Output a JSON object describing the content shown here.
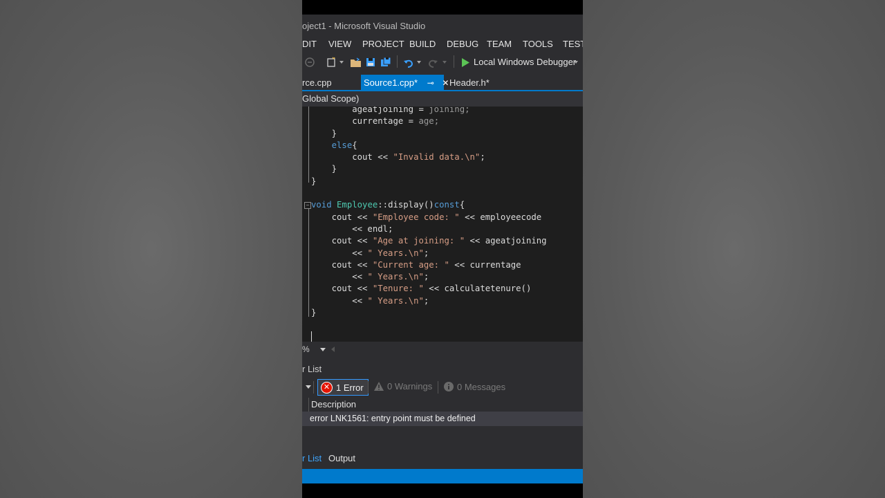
{
  "window": {
    "title": "oject1 - Microsoft Visual Studio"
  },
  "menu": [
    "DIT",
    "VIEW",
    "PROJECT",
    "BUILD",
    "DEBUG",
    "TEAM",
    "TOOLS",
    "TEST"
  ],
  "toolbar": {
    "debugger_label": "Local Windows Debugger"
  },
  "tabs": [
    {
      "label": "rce.cpp"
    },
    {
      "label": "Source1.cpp*",
      "active": true
    },
    {
      "label": "Header.h*"
    }
  ],
  "scope": {
    "label": "Global Scope)"
  },
  "editor": {
    "zoom": "%",
    "code": [
      [
        [
          "",
          "        ageatjoining = "
        ],
        [
          "dim",
          "joining;"
        ]
      ],
      [
        [
          "",
          "        currentage = "
        ],
        [
          "dim",
          "age;"
        ]
      ],
      [
        [
          "",
          "    }"
        ]
      ],
      [
        [
          "kw",
          "    else"
        ],
        [
          "",
          "{"
        ]
      ],
      [
        [
          "",
          "        cout << "
        ],
        [
          "st",
          "\"Invalid data.\\n\""
        ],
        [
          "",
          ";"
        ]
      ],
      [
        [
          "",
          "    }"
        ]
      ],
      [
        [
          "",
          "}"
        ]
      ],
      [
        [
          "",
          ""
        ]
      ],
      [
        [
          "kw",
          "void"
        ],
        [
          "",
          " "
        ],
        [
          "ty",
          "Employee"
        ],
        [
          "",
          "::display()"
        ],
        [
          "kw",
          "const"
        ],
        [
          "",
          "{"
        ]
      ],
      [
        [
          "",
          "    cout << "
        ],
        [
          "st",
          "\"Employee code: \""
        ],
        [
          "",
          " << employeecode"
        ]
      ],
      [
        [
          "",
          "        << endl;"
        ]
      ],
      [
        [
          "",
          "    cout << "
        ],
        [
          "st",
          "\"Age at joining: \""
        ],
        [
          "",
          " << ageatjoining"
        ]
      ],
      [
        [
          "",
          "        << "
        ],
        [
          "st",
          "\" Years.\\n\""
        ],
        [
          "",
          ";"
        ]
      ],
      [
        [
          "",
          "    cout << "
        ],
        [
          "st",
          "\"Current age: \""
        ],
        [
          "",
          " << currentage"
        ]
      ],
      [
        [
          "",
          "        << "
        ],
        [
          "st",
          "\" Years.\\n\""
        ],
        [
          "",
          ";"
        ]
      ],
      [
        [
          "",
          "    cout << "
        ],
        [
          "st",
          "\"Tenure: \""
        ],
        [
          "",
          " << calculatetenure()"
        ]
      ],
      [
        [
          "",
          "        << "
        ],
        [
          "st",
          "\" Years.\\n\""
        ],
        [
          "",
          ";"
        ]
      ],
      [
        [
          "",
          "}"
        ]
      ]
    ]
  },
  "error_list": {
    "title": "r List",
    "errors_label": "1 Error",
    "warnings_label": "0 Warnings",
    "messages_label": "0 Messages",
    "column_description": "Description",
    "rows": [
      {
        "description": "error LNK1561: entry point must be defined"
      }
    ]
  },
  "bottom_tabs": [
    {
      "label": "r List",
      "active": true
    },
    {
      "label": "Output"
    }
  ],
  "colors": {
    "accent": "#007acc",
    "editor_bg": "#1e1e1e",
    "chrome_bg": "#2d2d30"
  }
}
